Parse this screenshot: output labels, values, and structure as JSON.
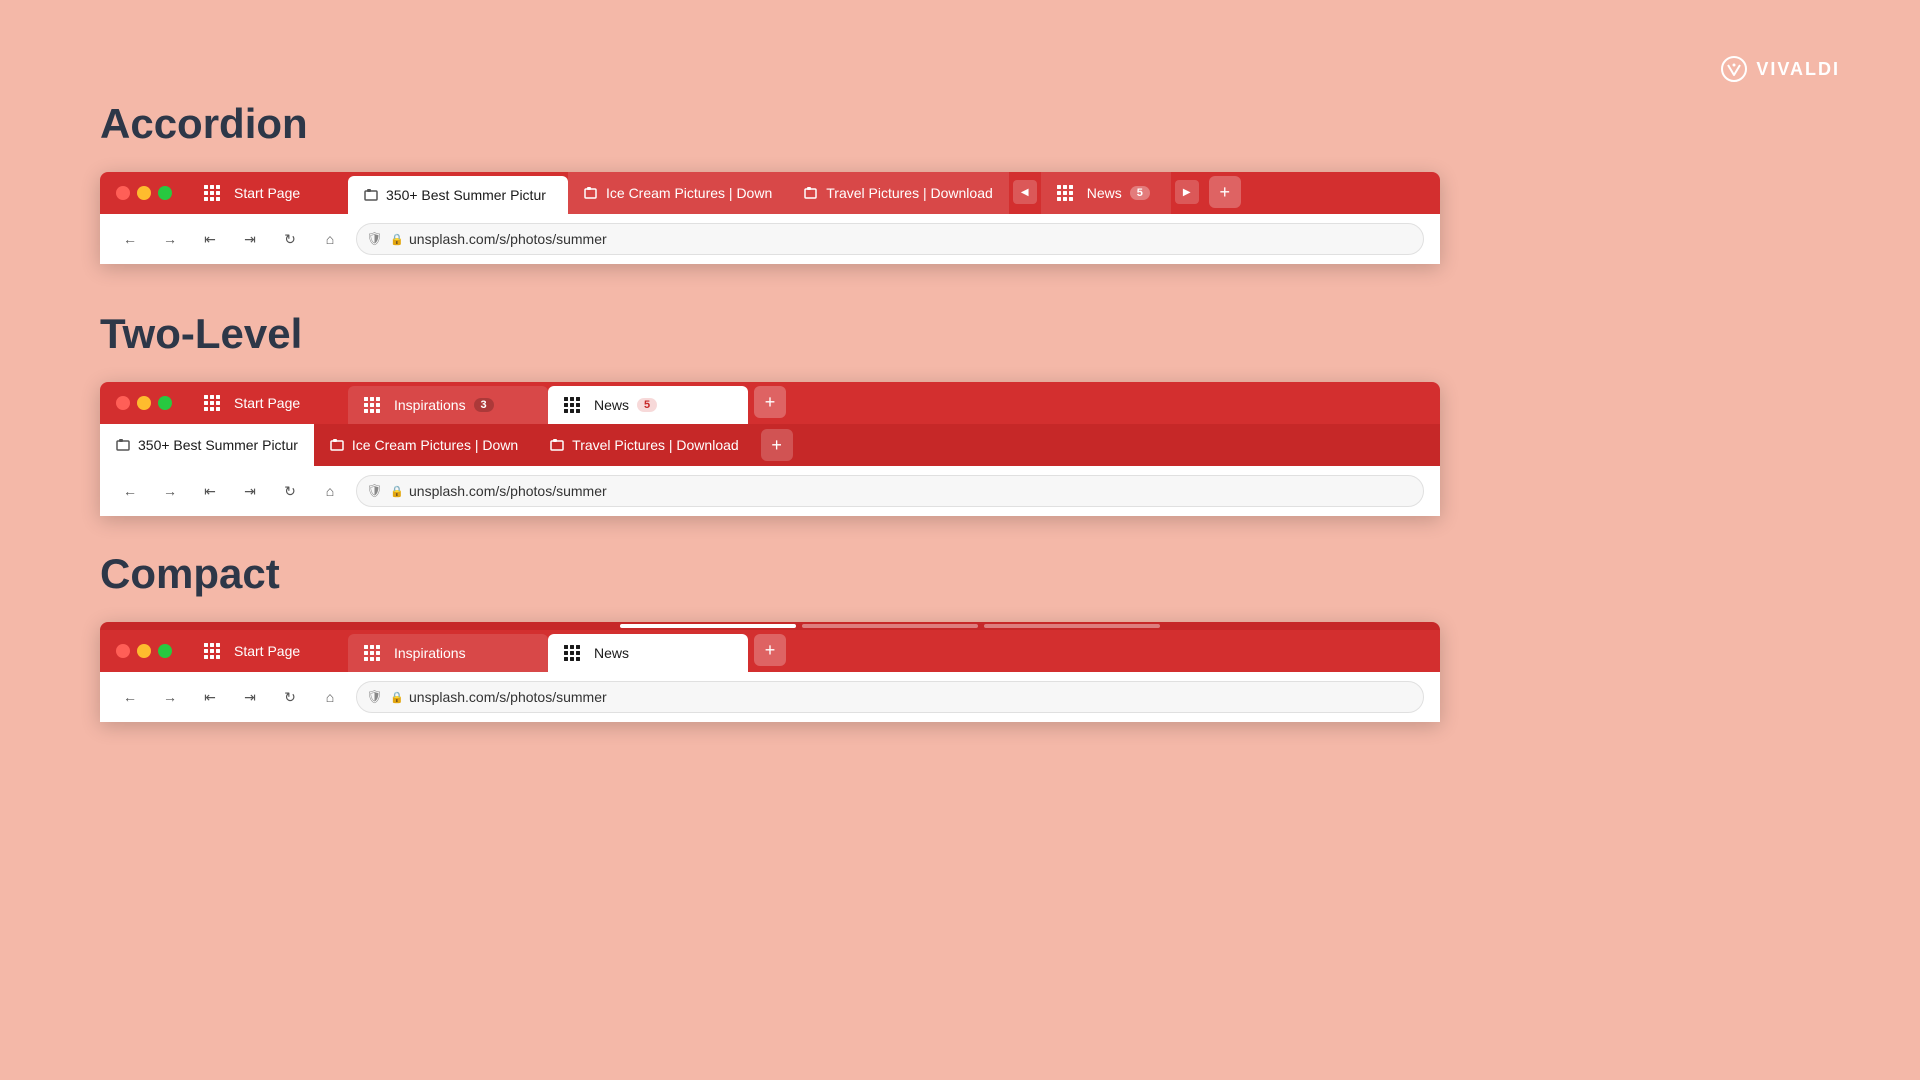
{
  "brand": {
    "name": "VIVALDI"
  },
  "sections": {
    "accordion": {
      "title": "Accordion",
      "browser": {
        "tabs": [
          {
            "id": "start",
            "label": "Start Page",
            "type": "start"
          },
          {
            "id": "summer",
            "label": "350+ Best Summer Pictur",
            "type": "active"
          },
          {
            "id": "icecream",
            "label": "Ice Cream Pictures | Down",
            "type": "group",
            "color": "#d32f2f"
          },
          {
            "id": "travel",
            "label": "Travel Pictures | Download",
            "type": "group",
            "color": "#d32f2f"
          },
          {
            "id": "news",
            "label": "News",
            "type": "group-collapsed",
            "badge": "5"
          }
        ],
        "address": "unsplash.com/s/photos/summer"
      }
    },
    "twoLevel": {
      "title": "Two-Level",
      "browser": {
        "topTabs": [
          {
            "id": "start",
            "label": "Start Page",
            "type": "start"
          },
          {
            "id": "inspirations",
            "label": "Inspirations",
            "type": "group",
            "badge": "3"
          },
          {
            "id": "news",
            "label": "News",
            "type": "group-selected",
            "badge": "5"
          }
        ],
        "bottomTabs": [
          {
            "id": "summer",
            "label": "350+ Best Summer Pictur",
            "type": "active"
          },
          {
            "id": "icecream",
            "label": "Ice Cream Pictures | Down",
            "type": "normal"
          },
          {
            "id": "travel",
            "label": "Travel Pictures | Download",
            "type": "normal"
          }
        ],
        "address": "unsplash.com/s/photos/summer"
      }
    },
    "compact": {
      "title": "Compact",
      "browser": {
        "tabs": [
          {
            "id": "start",
            "label": "Start Page",
            "type": "start"
          },
          {
            "id": "inspirations",
            "label": "Inspirations",
            "type": "group"
          },
          {
            "id": "news",
            "label": "News",
            "type": "group-selected"
          }
        ],
        "subIndicators": [
          {
            "active": true
          },
          {
            "active": false
          },
          {
            "active": false
          }
        ],
        "address": "unsplash.com/s/photos/summer"
      }
    }
  }
}
